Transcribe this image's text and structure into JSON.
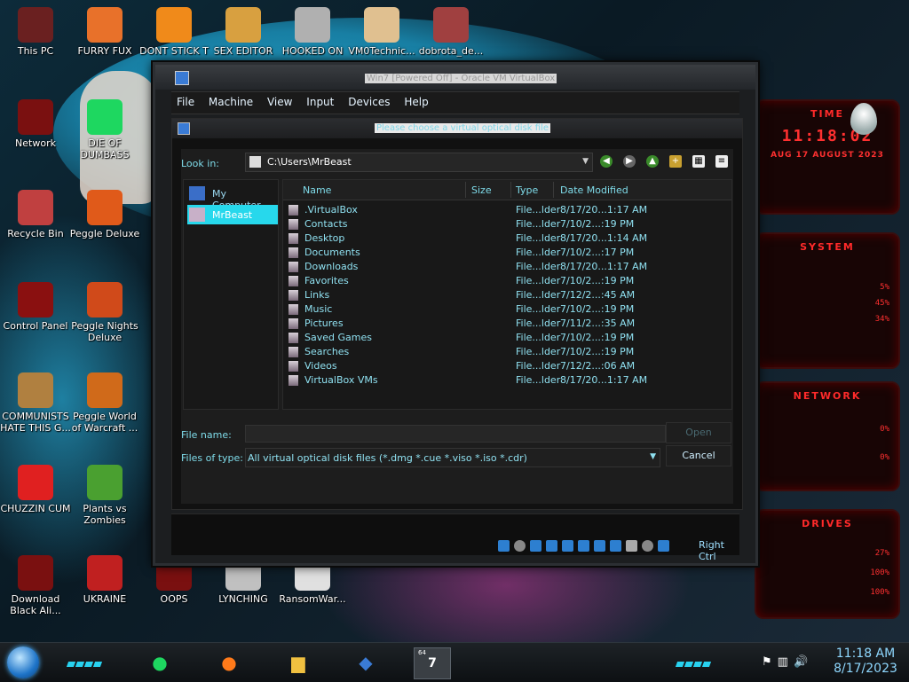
{
  "desktop_icons": [
    {
      "label": "This PC",
      "icon": "computer-icon",
      "color": "#6a2020"
    },
    {
      "label": "FURRY FUX",
      "icon": "firefox-icon",
      "color": "#e8712a"
    },
    {
      "label": "DONT STICK T",
      "icon": "vlc-icon",
      "color": "#f08a1a"
    },
    {
      "label": "SEX EDITOR",
      "icon": "hxd-icon",
      "color": "#d8a040"
    },
    {
      "label": "HOOKED ON",
      "icon": "maze-icon",
      "color": "#b0b0b0"
    },
    {
      "label": "VM0Technic...",
      "icon": "doctor-icon",
      "color": "#e0c090"
    },
    {
      "label": "dobrota_de...",
      "icon": "archive-icon",
      "color": "#a04040"
    },
    {
      "label": "Network",
      "icon": "network-icon",
      "color": "#7a1010"
    },
    {
      "label": "DIE OF DUMBASS",
      "icon": "spotify-icon",
      "color": "#1ed760"
    },
    {
      "label": "Recycle Bin",
      "icon": "recycle-bin-icon",
      "color": "#c04040"
    },
    {
      "label": "Peggle Deluxe",
      "icon": "peggle-icon",
      "color": "#e05a1a"
    },
    {
      "label": "Control Panel",
      "icon": "control-panel-icon",
      "color": "#8a1010"
    },
    {
      "label": "Peggle Nights Deluxe",
      "icon": "peggle-nights-icon",
      "color": "#d04a1a"
    },
    {
      "label": "COMMUNISTS HATE THIS G...",
      "icon": "money-bag-icon",
      "color": "#b08040"
    },
    {
      "label": "Peggle World of Warcraft ...",
      "icon": "peggle-wow-icon",
      "color": "#d06a1a"
    },
    {
      "label": "CHUZZIN CUM",
      "icon": "chuzzle-icon",
      "color": "#e02020"
    },
    {
      "label": "Plants vs Zombies",
      "icon": "pvz-icon",
      "color": "#4aa030"
    },
    {
      "label": "Download Black Ali...",
      "icon": "alien-download-icon",
      "color": "#7a1010"
    },
    {
      "label": "UKRAINE",
      "icon": "radiation-icon",
      "color": "#c02020"
    },
    {
      "label": "OOPS",
      "icon": "oops-icon",
      "color": "#7a1010"
    },
    {
      "label": "LYNCHING",
      "icon": "gear-shield-icon",
      "color": "#c0c0c0"
    },
    {
      "label": "RansomWar...",
      "icon": "skull-icon",
      "color": "#e0e0e0"
    }
  ],
  "gadgets": {
    "time": {
      "title": "TIME",
      "clock": "11:18:02",
      "date": "AUG 17 AUGUST 2023"
    },
    "system": {
      "title": "SYSTEM",
      "rows": [
        "5%",
        "45%",
        "34%"
      ]
    },
    "network": {
      "title": "NETWORK",
      "rows": [
        "0%",
        "0%"
      ]
    },
    "drives": {
      "title": "DRIVES",
      "rows": [
        "27%",
        "100%",
        "100%"
      ]
    }
  },
  "vm_window": {
    "title": "Win7 [Powered Off] - Oracle VM VirtualBox",
    "menu": [
      "File",
      "Machine",
      "View",
      "Input",
      "Devices",
      "Help"
    ],
    "status_right": "Right Ctrl"
  },
  "dialog": {
    "title": "Please choose a virtual optical disk file",
    "look_in_label": "Look in:",
    "look_in_value": "C:\\Users\\MrBeast",
    "places": [
      {
        "label": "My Computer",
        "selected": false
      },
      {
        "label": "MrBeast",
        "selected": true
      }
    ],
    "columns": [
      "Name",
      "Size",
      "Type",
      "Date Modified"
    ],
    "files": [
      {
        "name": ".VirtualBox",
        "type": "File...lder",
        "date": "8/17/20...1:17 AM"
      },
      {
        "name": "Contacts",
        "type": "File...lder",
        "date": "7/10/2...:19 PM"
      },
      {
        "name": "Desktop",
        "type": "File...lder",
        "date": "8/17/20...1:14 AM"
      },
      {
        "name": "Documents",
        "type": "File...lder",
        "date": "7/10/2...:17 PM"
      },
      {
        "name": "Downloads",
        "type": "File...lder",
        "date": "8/17/20...1:17 AM"
      },
      {
        "name": "Favorites",
        "type": "File...lder",
        "date": "7/10/2...:19 PM"
      },
      {
        "name": "Links",
        "type": "File...lder",
        "date": "7/12/2...:45 AM"
      },
      {
        "name": "Music",
        "type": "File...lder",
        "date": "7/10/2...:19 PM"
      },
      {
        "name": "Pictures",
        "type": "File...lder",
        "date": "7/11/2...:35 AM"
      },
      {
        "name": "Saved Games",
        "type": "File...lder",
        "date": "7/10/2...:19 PM"
      },
      {
        "name": "Searches",
        "type": "File...lder",
        "date": "7/10/2...:19 PM"
      },
      {
        "name": "Videos",
        "type": "File...lder",
        "date": "7/12/2...:06 AM"
      },
      {
        "name": "VirtualBox VMs",
        "type": "File...lder",
        "date": "8/17/20...1:17 AM"
      }
    ],
    "file_name_label": "File name:",
    "file_name_value": "",
    "files_of_type_label": "Files of type:",
    "files_of_type_value": "All virtual optical disk files (*.dmg *.cue *.viso *.iso *.cdr)",
    "open_label": "Open",
    "cancel_label": "Cancel"
  },
  "taskbar": {
    "apps": [
      "spotify-icon",
      "firefox-icon",
      "file-explorer-icon",
      "virtualbox-icon",
      "win7-vm-icon"
    ],
    "vm_badge": "7",
    "vm_badge_top": "64",
    "time": "11:18 AM",
    "date": "8/17/2023"
  },
  "colors": {
    "accent_cyan": "#27d8ec",
    "gadget_red": "#ff2a2a",
    "dialog_bg": "#1d1d1d"
  }
}
